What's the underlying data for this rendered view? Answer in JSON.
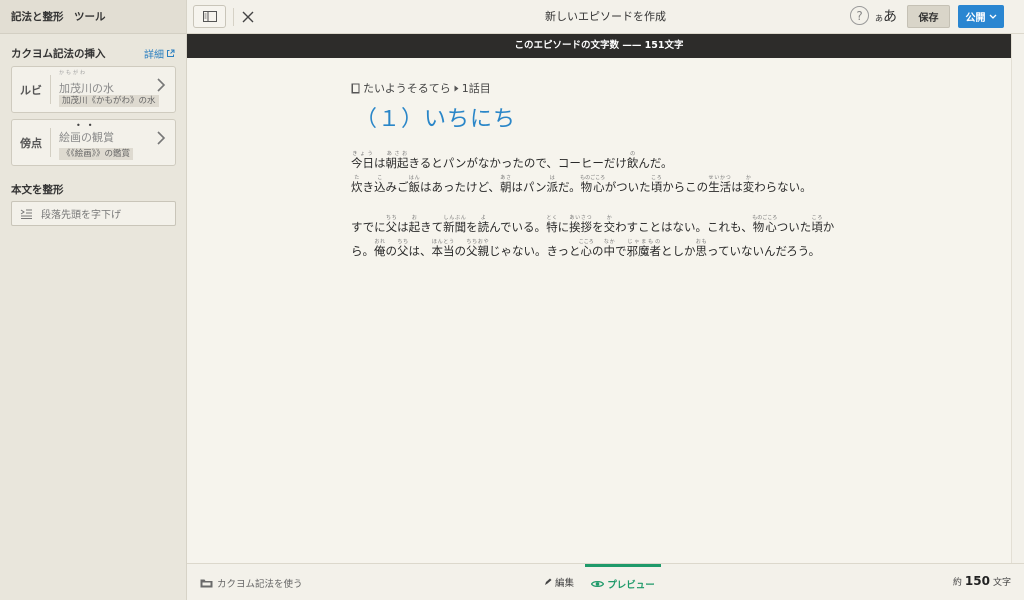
{
  "sidebar": {
    "title": "記法と整形　ツール",
    "insert_heading": "カクヨム記法の挿入",
    "detail_link": "詳細",
    "ruby": {
      "label": "ルビ",
      "example_base": "加茂川の水",
      "example_reading": "かもがわ",
      "example_syntax": "加茂川《かもがわ》の水"
    },
    "emphasis": {
      "label": "傍点",
      "example_text": "絵画の観賞",
      "example_syntax": "《《絵画》》の鑑賞"
    },
    "format_heading": "本文を整形",
    "indent_button": "段落先頭を字下げ"
  },
  "topbar": {
    "title": "新しいエピソードを作成",
    "help": "?",
    "font_small": "あ",
    "font_large": "あ",
    "save": "保存",
    "publish": "公開"
  },
  "countbar": {
    "label": "このエピソードの文字数 —— 151文字"
  },
  "content": {
    "breadcrumb_work": "たいようそるてら",
    "breadcrumb_episode": "1話目",
    "episode_title": "（１）いちにち"
  },
  "bottombar": {
    "kakuyomu_toggle": "カクヨム記法を使う",
    "edit": "編集",
    "preview": "プレビュー",
    "count_prefix": "約",
    "count_value": "150",
    "count_suffix": "文字"
  },
  "colors": {
    "accent_blue": "#2a86d1",
    "preview_green": "#1f9a6a",
    "countbar_bg": "#2d2c2a"
  }
}
